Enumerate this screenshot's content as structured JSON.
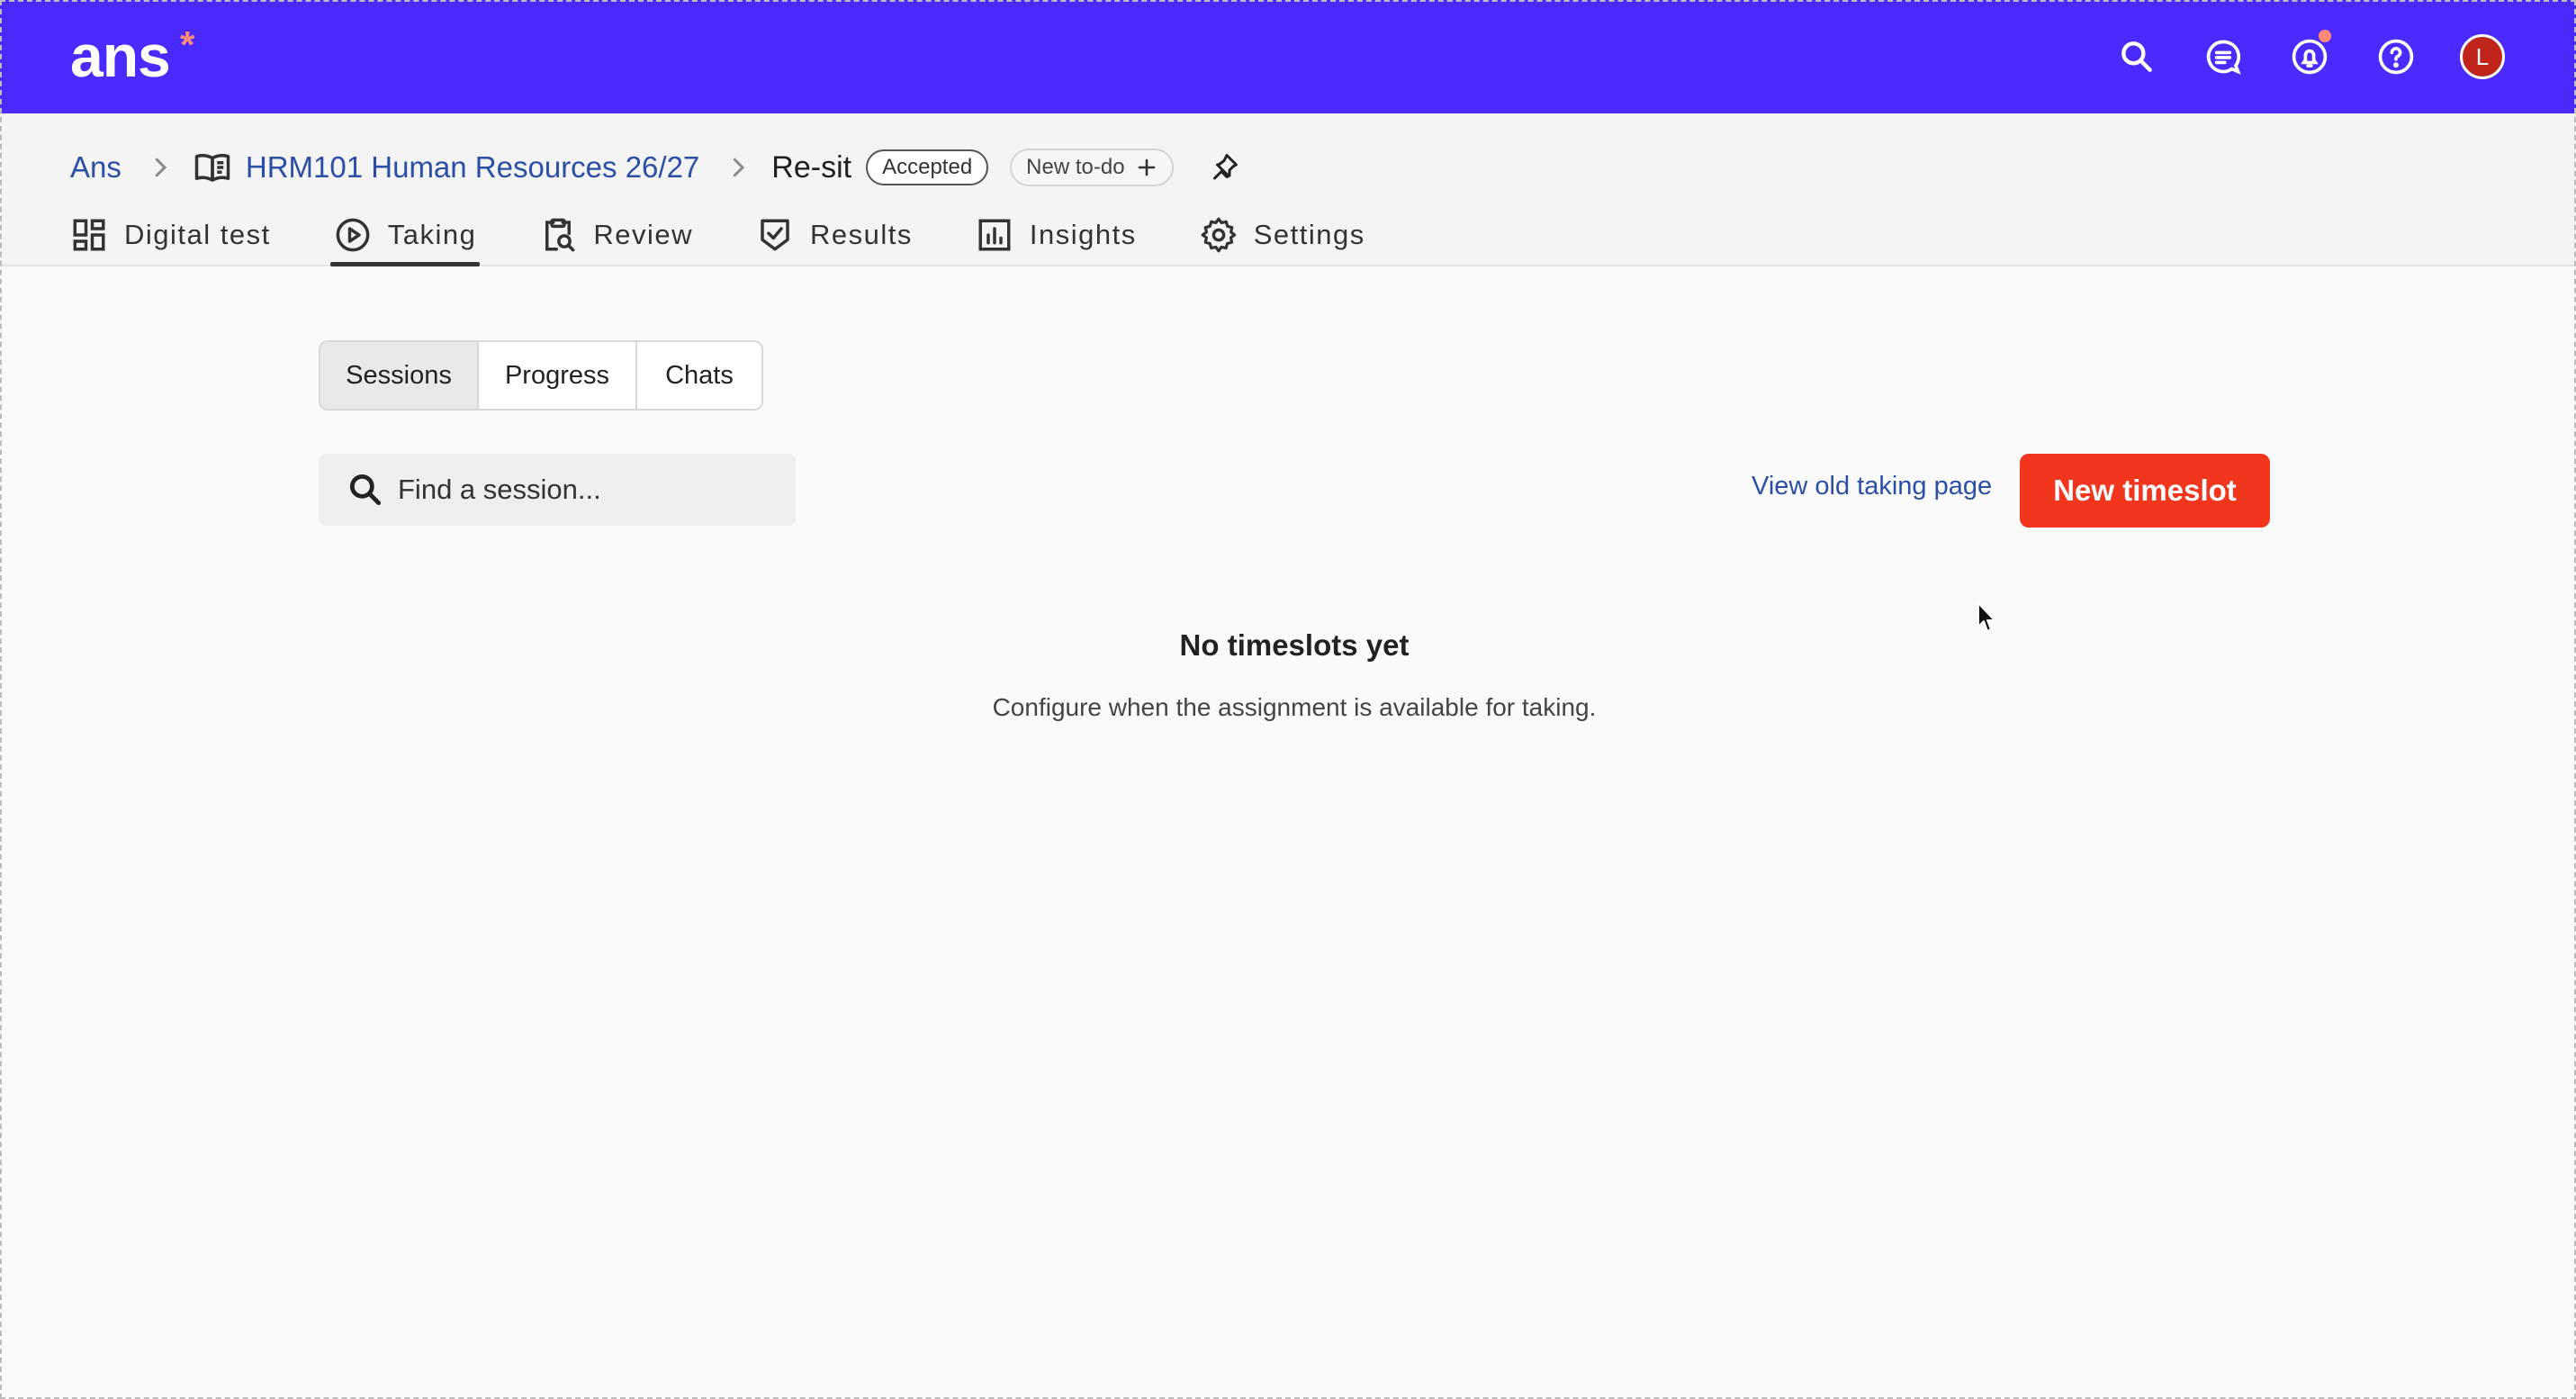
{
  "app": {
    "logo_text": "ans",
    "logo_mark": "*",
    "brand_color": "#4a2bff",
    "accent_color": "#f2361d",
    "top_icons": [
      "search-icon",
      "chat-icon",
      "notification-bell-icon",
      "help-icon"
    ],
    "avatar_initial": "L"
  },
  "breadcrumb": {
    "root": "Ans",
    "course": "HRM101 Human Resources 26/27",
    "current": "Re-sit",
    "status_badge": "Accepted",
    "todo_label": "New to-do"
  },
  "tabs": [
    {
      "label": "Digital test",
      "icon": "grid-icon",
      "active": false
    },
    {
      "label": "Taking",
      "icon": "play-circle-icon",
      "active": true
    },
    {
      "label": "Review",
      "icon": "clipboard-search-icon",
      "active": false
    },
    {
      "label": "Results",
      "icon": "check-badge-icon",
      "active": false
    },
    {
      "label": "Insights",
      "icon": "bar-chart-icon",
      "active": false
    },
    {
      "label": "Settings",
      "icon": "gear-icon",
      "active": false
    }
  ],
  "subtabs": [
    {
      "label": "Sessions",
      "active": true
    },
    {
      "label": "Progress",
      "active": false
    },
    {
      "label": "Chats",
      "active": false
    }
  ],
  "search": {
    "placeholder": "Find a session...",
    "value": ""
  },
  "actions": {
    "old_page_link": "View old taking page",
    "new_timeslot": "New timeslot"
  },
  "empty_state": {
    "title": "No timeslots yet",
    "subtitle": "Configure when the assignment is available for taking."
  }
}
